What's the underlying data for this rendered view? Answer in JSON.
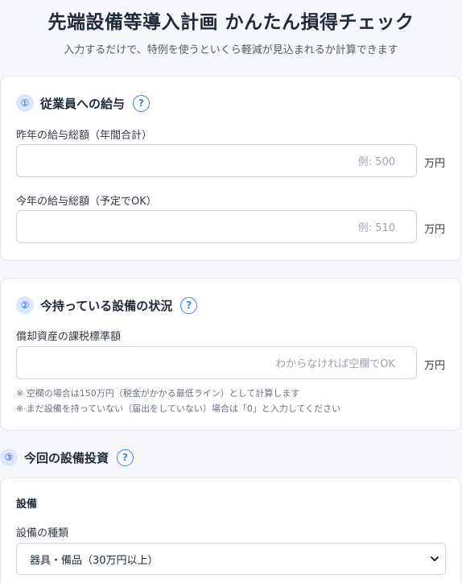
{
  "header": {
    "title": "先端設備等導入計画 かんたん損得チェック",
    "subtitle": "入力するだけで、特例を使うといくら軽減が見込まれるか計算できます"
  },
  "section1": {
    "number": "①",
    "title": "従業員への給与",
    "help": "?",
    "field1": {
      "label": "昨年の給与総額（年間合計）",
      "placeholder": "例: 500",
      "unit": "万円"
    },
    "field2": {
      "label": "今年の給与総額（予定でOK）",
      "placeholder": "例: 510",
      "unit": "万円"
    }
  },
  "section2": {
    "number": "②",
    "title": "今持っている設備の状況",
    "help": "?",
    "field": {
      "label": "償却資産の課税標準額",
      "placeholder": "わからなければ空欄でOK",
      "unit": "万円"
    },
    "notes": [
      "※ 空欄の場合は150万円（税金がかかる最低ライン）として計算します",
      "※ まだ設備を持っていない（届出をしていない）場合は「0」と入力してください"
    ]
  },
  "section3": {
    "number": "③",
    "title": "今回の設備投資",
    "help": "?",
    "sub_heading": "設備",
    "type_label": "設備の種類",
    "type_selected": "器具・備品（30万円以上）"
  },
  "icons": {
    "help": "question-icon",
    "dropdown": "chevron-down-icon"
  },
  "colors": {
    "accent": "#3b82f6",
    "badge_bg": "#dbe7fb"
  }
}
